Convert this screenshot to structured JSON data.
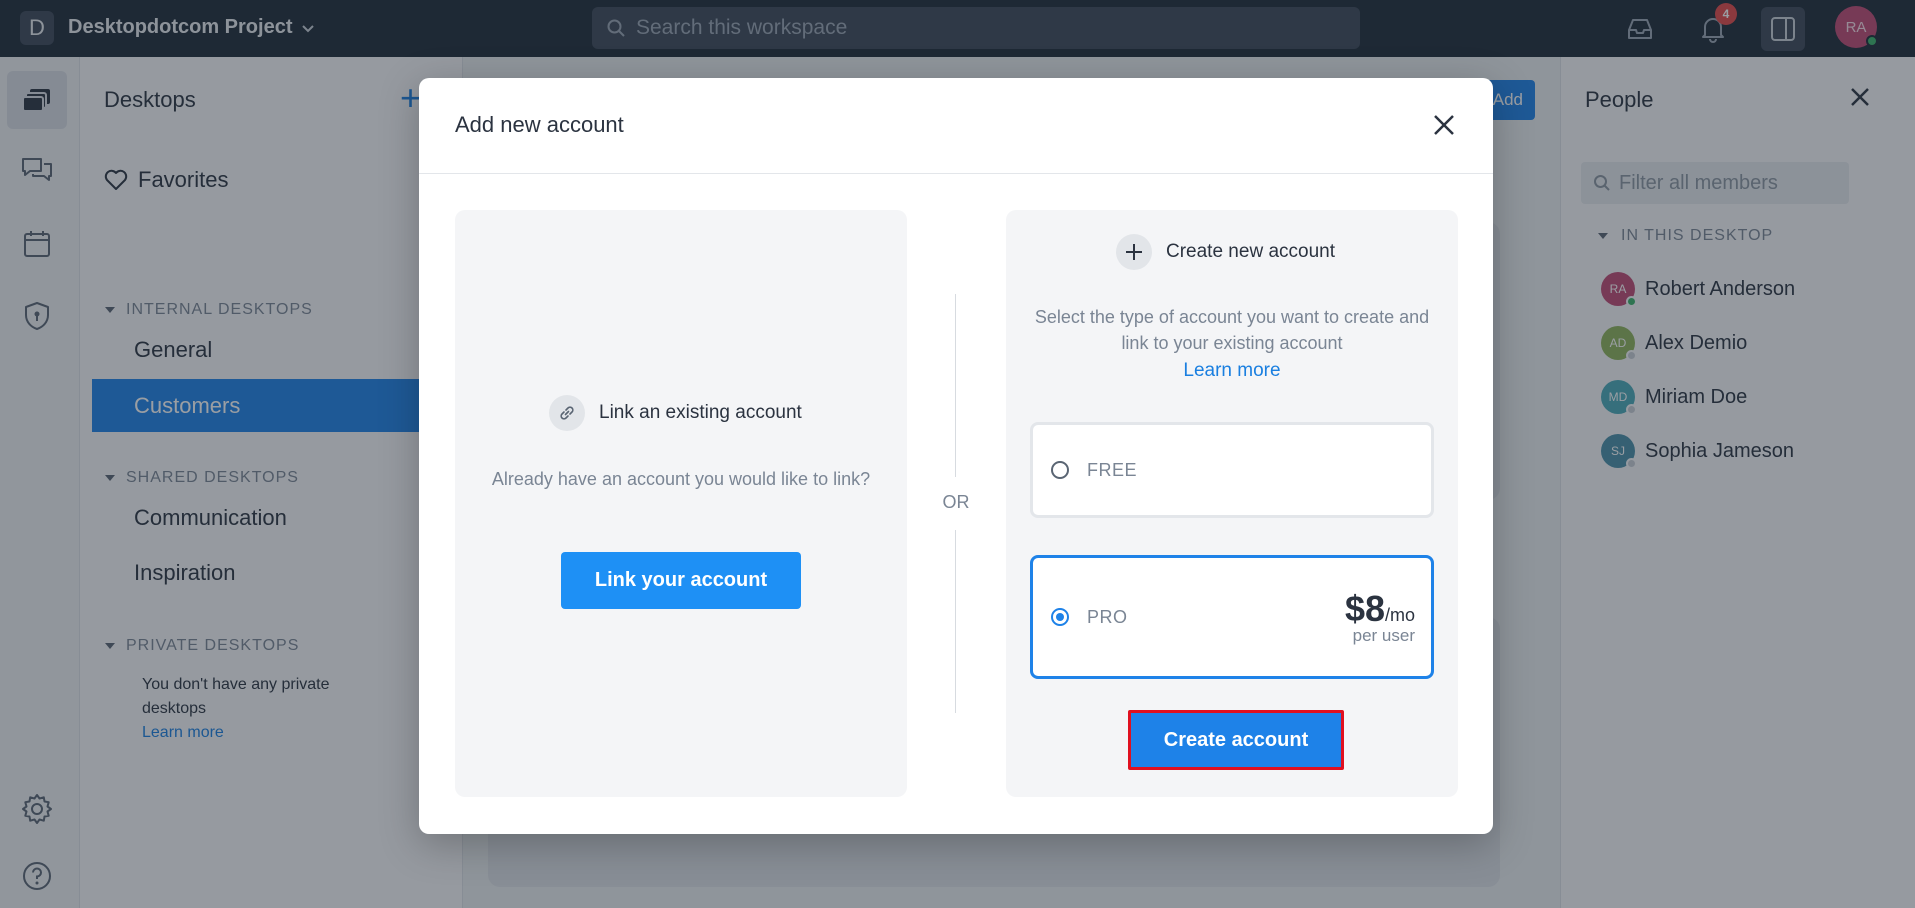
{
  "topbar": {
    "workspace_initial": "D",
    "workspace_name": "Desktopdotcom Project",
    "search_placeholder": "Search this workspace",
    "notification_count": "4",
    "user_initials": "RA"
  },
  "sidebar": {
    "title": "Desktops",
    "favorites": "Favorites",
    "internal_section": "INTERNAL DESKTOPS",
    "internal_items": [
      "General",
      "Customers"
    ],
    "shared_section": "SHARED DESKTOPS",
    "shared_items": [
      "Communication",
      "Inspiration"
    ],
    "private_section": "PRIVATE DESKTOPS",
    "private_note": "You don't have any private desktops",
    "private_link": "Learn more"
  },
  "main": {
    "add_label": "Add"
  },
  "people": {
    "title": "People",
    "filter_placeholder": "Filter all members",
    "section": "IN THIS DESKTOP",
    "members": [
      {
        "initials": "RA",
        "name": "Robert Anderson",
        "color": "#c04a74",
        "status": "#3bb36a"
      },
      {
        "initials": "AD",
        "name": "Alex Demio",
        "color": "#8fb35a",
        "status": "#c9ced5"
      },
      {
        "initials": "MD",
        "name": "Miriam Doe",
        "color": "#4aa9b8",
        "status": "#c9ced5"
      },
      {
        "initials": "SJ",
        "name": "Sophia Jameson",
        "color": "#4a8fa8",
        "status": "#c9ced5"
      }
    ]
  },
  "modal": {
    "title": "Add new account",
    "or": "OR",
    "link": {
      "heading": "Link an existing account",
      "description": "Already have an account you would like to link?",
      "button": "Link your account"
    },
    "create": {
      "heading": "Create new account",
      "description": "Select the type of account you want to create and link to your existing account",
      "learn_more": "Learn more",
      "plans": [
        {
          "label": "FREE",
          "selected": false
        },
        {
          "label": "PRO",
          "selected": true,
          "price": "$8",
          "unit": "/mo",
          "per": "per user"
        }
      ],
      "button": "Create account"
    }
  },
  "colors": {
    "accent": "#1e82e8",
    "topbar": "#1e2a38",
    "highlight_border": "#e0101f"
  }
}
